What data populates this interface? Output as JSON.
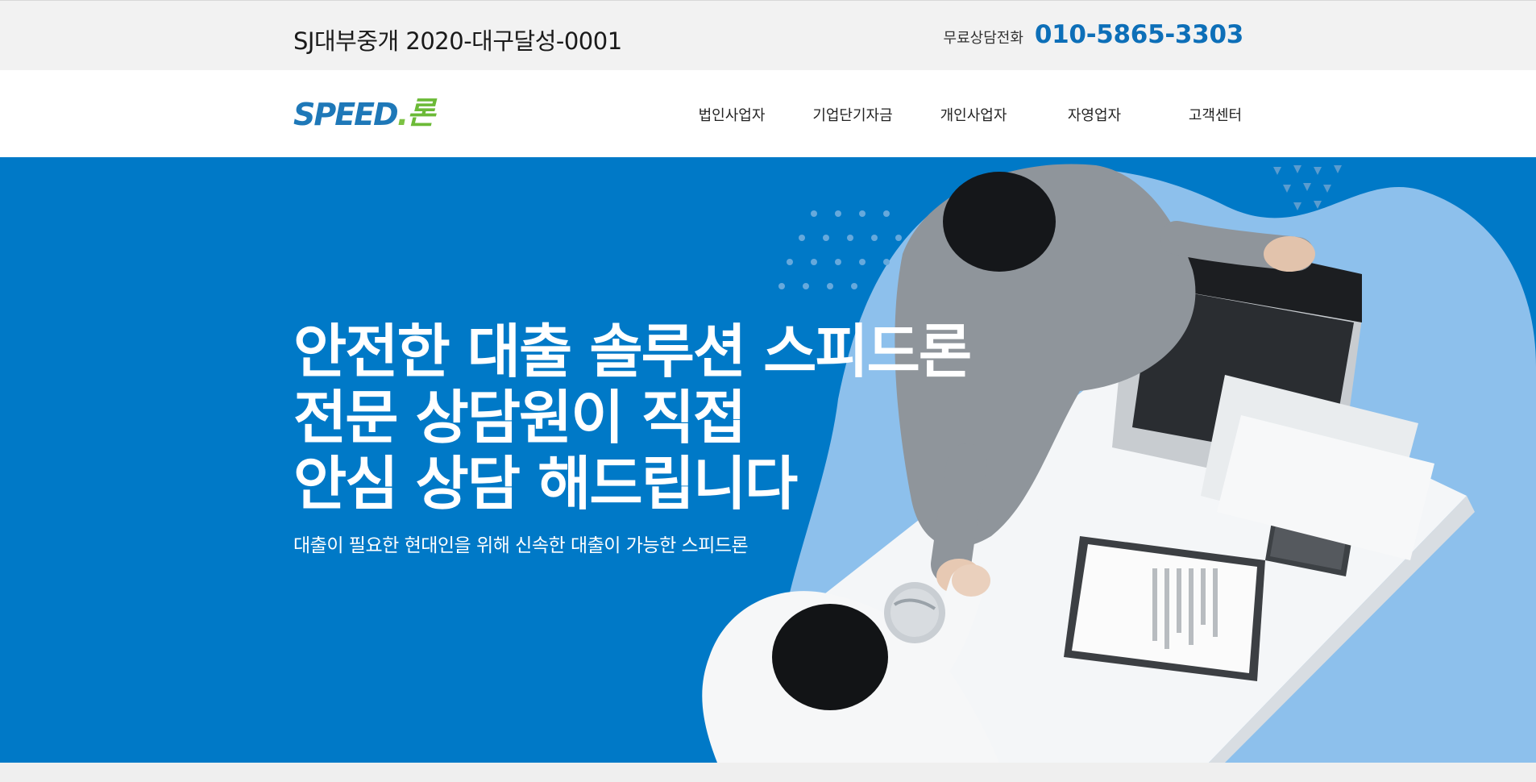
{
  "topbar": {
    "registration": "SJ대부중개 2020-대구달성-0001",
    "phone_label": "무료상담전화",
    "phone_number": "010-5865-3303"
  },
  "logo": {
    "speed": "SPEED",
    "dot": ".",
    "ron": "론"
  },
  "nav": {
    "items": [
      {
        "label": "법인사업자"
      },
      {
        "label": "기업단기자금"
      },
      {
        "label": "개인사업자"
      },
      {
        "label": "자영업자"
      },
      {
        "label": "고객센터"
      }
    ]
  },
  "hero": {
    "headline": [
      "안전한 대출 솔루션 스피드론",
      "전문 상담원이 직접",
      "안심 상담 해드립니다"
    ],
    "subcopy": "대출이 필요한 현대인을 위해 신속한 대출이 가능한 스피드론",
    "image_subject": "business-handshake-photo"
  },
  "colors": {
    "brand_blue": "#0079c7",
    "phone_blue": "#0d6fb8",
    "logo_green": "#6cba37",
    "topbar_bg": "#f2f2f2"
  }
}
